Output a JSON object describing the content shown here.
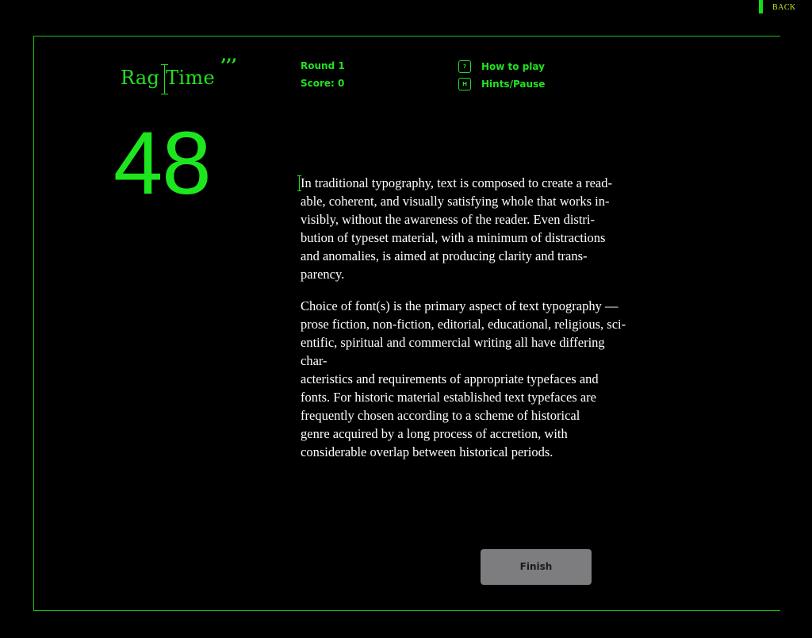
{
  "nav": {
    "back_label": "BACK"
  },
  "logo": {
    "text": "Rag Time",
    "quotes": "’’’"
  },
  "stats": {
    "round": "Round 1",
    "score": "Score: 0"
  },
  "menu": {
    "how_to_play_key": "?",
    "how_to_play_label": "How to play",
    "hints_key": "H",
    "hints_label": "Hints/Pause"
  },
  "timer": {
    "value": "48"
  },
  "content": {
    "paragraph_1": "In traditional typography, text is composed to create a read-\nable, coherent, and visually satisfying whole that works in-\nvisibly, without the awareness of the reader. Even distri-\nbution of typeset material, with a minimum of distractions\nand anomalies, is aimed at producing clarity and trans-\nparency.",
    "paragraph_2": "Choice of font(s) is the primary aspect of text typography —\nprose fiction, non-fiction, editorial, educational, religious, sci-\nentific, spiritual and commercial writing all have differing\nchar-\nacteristics and requirements of appropriate typefaces and\nfonts. For historic material established text typefaces are\nfrequently chosen according to a scheme of historical\ngenre acquired by a long process of accretion, with\nconsiderable overlap between historical periods."
  },
  "actions": {
    "finish_label": "Finish"
  },
  "colors": {
    "background": "#000000",
    "accent": "#22e022",
    "back_link_text": "#c6e41c",
    "body_text": "#ffffff",
    "button_bg": "#7d7d7f"
  },
  "icons": {
    "logo_cursor": "text-cursor-icon",
    "text_caret": "text-cursor-icon"
  }
}
